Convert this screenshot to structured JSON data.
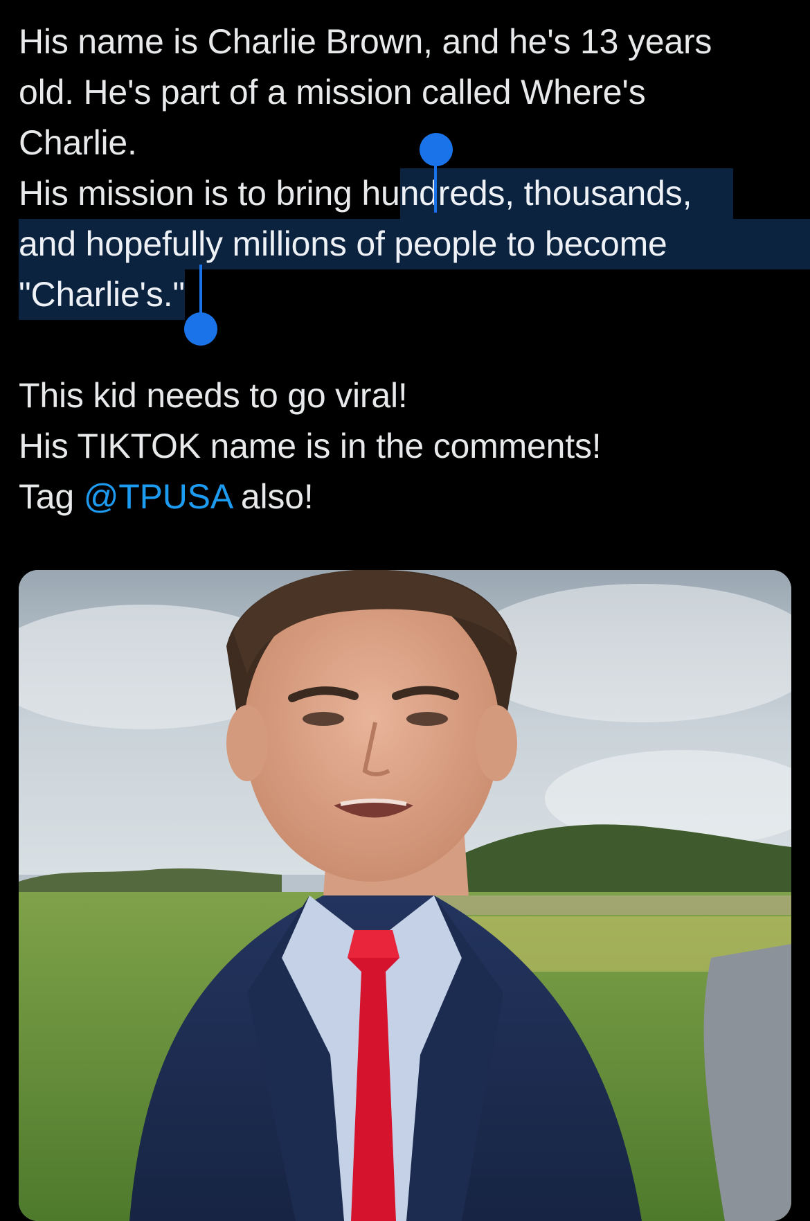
{
  "tweet": {
    "line1": "His name is Charlie Brown, and he's 13 years",
    "line2": "old. He's part of a mission called Where's",
    "line3": "Charlie.",
    "line4_plain": "His mission is to bring hu",
    "line4_selected": "ndreds, thousands,",
    "line5_selected": "and hopefully millions of people to become",
    "line6_selected": "\"Charlie's.\"",
    "line7": "This kid needs to go viral!",
    "line8": "His TIKTOK name is in the comments!",
    "line9_prefix": "Tag ",
    "mention": "@TPUSA",
    "line9_suffix": " also!"
  },
  "colors": {
    "background": "#000000",
    "text": "#e7e9ea",
    "mention": "#1d9bf0",
    "selection": "#0c2340",
    "selection_handle": "#1a73e8"
  },
  "media": {
    "type": "video-thumbnail",
    "subject": "boy in navy suit and red tie outdoors"
  }
}
